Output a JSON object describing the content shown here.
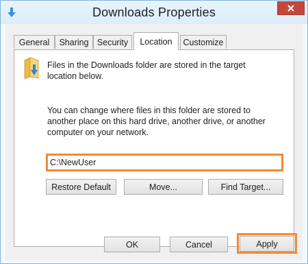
{
  "window": {
    "title": "Downloads Properties"
  },
  "tabs": [
    {
      "label": "General"
    },
    {
      "label": "Sharing"
    },
    {
      "label": "Security"
    },
    {
      "label": "Location"
    },
    {
      "label": "Customize"
    }
  ],
  "active_tab": "Location",
  "location": {
    "info_text": "Files in the Downloads folder are stored in the target location below.",
    "description": "You can change where files in this folder are stored to another place on this hard drive, another drive, or another computer on your network.",
    "path_value": "C:\\NewUser",
    "restore_default_label": "Restore Default",
    "move_label": "Move...",
    "find_target_label": "Find Target..."
  },
  "footer": {
    "ok_label": "OK",
    "cancel_label": "Cancel",
    "apply_label": "Apply"
  },
  "colors": {
    "highlight": "#f08a34",
    "close_button": "#c7463b",
    "window_frame": "#7fb3dc"
  },
  "icons": {
    "title_icon": "downloads-arrow-icon",
    "folder_icon": "downloads-folder-icon",
    "close_icon": "close-x-icon"
  }
}
